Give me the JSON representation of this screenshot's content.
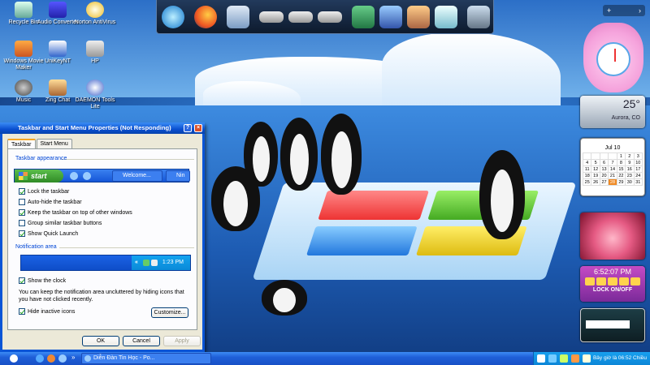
{
  "desktop": {
    "icons": [
      {
        "label": "Recycle Bin"
      },
      {
        "label": "Audio Converter"
      },
      {
        "label": "Norton AntiVirus"
      },
      {
        "label": "Windows Movie Maker"
      },
      {
        "label": "UniKeyNT"
      },
      {
        "label": "HP"
      },
      {
        "label": "Music"
      },
      {
        "label": "Zing Chat"
      },
      {
        "label": "DAEMON Tools Lite"
      }
    ]
  },
  "dock": {
    "items": [
      "internet-explorer-icon",
      "firefox-icon",
      "my-computer-icon",
      "drive-icon",
      "drive-icon",
      "drive-icon",
      "notebook-icon",
      "picture-icon",
      "tools-icon",
      "notepad-icon",
      "recycle-bin-icon"
    ]
  },
  "gadgets": {
    "bar": {
      "add": "+",
      "next": "›"
    },
    "weather": {
      "temp": "25°",
      "location": "Aurora, CO"
    },
    "calendar": {
      "month": "Jul 10",
      "days": [
        [
          "",
          "",
          "",
          "",
          "1",
          "2",
          "3"
        ],
        [
          "4",
          "5",
          "6",
          "7",
          "8",
          "9",
          "10"
        ],
        [
          "11",
          "12",
          "13",
          "14",
          "15",
          "16",
          "17"
        ],
        [
          "18",
          "19",
          "20",
          "21",
          "22",
          "23",
          "24"
        ],
        [
          "25",
          "26",
          "27",
          "28",
          "29",
          "30",
          "31"
        ]
      ],
      "today": "28"
    },
    "clock": {
      "time": "6:52:07 PM",
      "lock": "LOCK ON/OFF"
    }
  },
  "dialog": {
    "title": "Taskbar and Start Menu Properties (Not Responding)",
    "tabs": [
      "Taskbar",
      "Start Menu"
    ],
    "taskbar_appearance": "Taskbar appearance",
    "preview": {
      "start": "start",
      "btn1": "Welcome...",
      "btn2": "Nin"
    },
    "options": [
      {
        "label": "Lock the taskbar",
        "checked": true
      },
      {
        "label": "Auto-hide the taskbar",
        "checked": false
      },
      {
        "label": "Keep the taskbar on top of other windows",
        "checked": true
      },
      {
        "label": "Group similar taskbar buttons",
        "checked": false
      },
      {
        "label": "Show Quick Launch",
        "checked": true
      }
    ],
    "notification_area": "Notification area",
    "tray_time": "1:23 PM",
    "show_clock": "Show the clock",
    "info": "You can keep the notification area uncluttered by hiding icons that you have not clicked recently.",
    "hide_inactive": "Hide inactive icons",
    "customize": "Customize...",
    "ok": "OK",
    "cancel": "Cancel",
    "apply": "Apply"
  },
  "taskbar": {
    "task": "Diễn Đàn Tin Học - Po...",
    "clock": "Bây giờ là 06:52 Chiều"
  }
}
